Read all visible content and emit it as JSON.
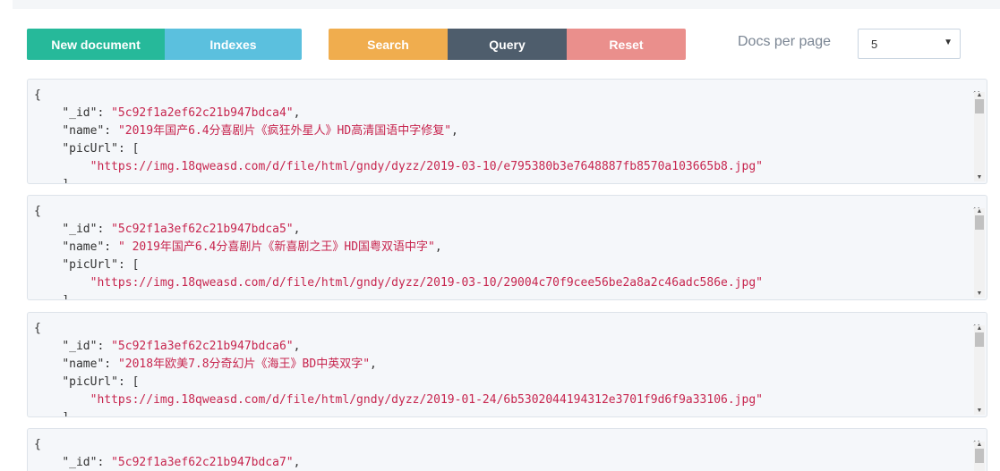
{
  "toolbar": {
    "new_document": "New document",
    "indexes": "Indexes",
    "search": "Search",
    "query": "Query",
    "reset": "Reset",
    "docs_per_page_label": "Docs per page",
    "docs_per_page_value": "5"
  },
  "docs": [
    {
      "open": "{",
      "id_key": "\"_id\"",
      "id": "\"5c92f1a2ef62c21b947bdca4\"",
      "name_key": "\"name\"",
      "name": "\"2019年国产6.4分喜剧片《疯狂外星人》HD高清国语中字修复\"",
      "pic_key": "\"picUrl\"",
      "pic_open": "[",
      "url": "\"https://img.18qweasd.com/d/file/html/gndy/dyzz/2019-03-10/e795380b3e7648887fb8570a103665b8.jpg\"",
      "close": "]"
    },
    {
      "open": "{",
      "id_key": "\"_id\"",
      "id": "\"5c92f1a3ef62c21b947bdca5\"",
      "name_key": "\"name\"",
      "name": "\" 2019年国产6.4分喜剧片《新喜剧之王》HD国粤双语中字\"",
      "pic_key": "\"picUrl\"",
      "pic_open": "[",
      "url": "\"https://img.18qweasd.com/d/file/html/gndy/dyzz/2019-03-10/29004c70f9cee56be2a8a2c46adc586e.jpg\"",
      "close": "]"
    },
    {
      "open": "{",
      "id_key": "\"_id\"",
      "id": "\"5c92f1a3ef62c21b947bdca6\"",
      "name_key": "\"name\"",
      "name": "\"2018年欧美7.8分奇幻片《海王》BD中英双字\"",
      "pic_key": "\"picUrl\"",
      "pic_open": "[",
      "url": "\"https://img.18qweasd.com/d/file/html/gndy/dyzz/2019-01-24/6b5302044194312e3701f9d6f9a33106.jpg\"",
      "close": "]"
    },
    {
      "open": "{",
      "id_key": "\"_id\"",
      "id": "\"5c92f1a3ef62c21b947bdca7\""
    }
  ]
}
